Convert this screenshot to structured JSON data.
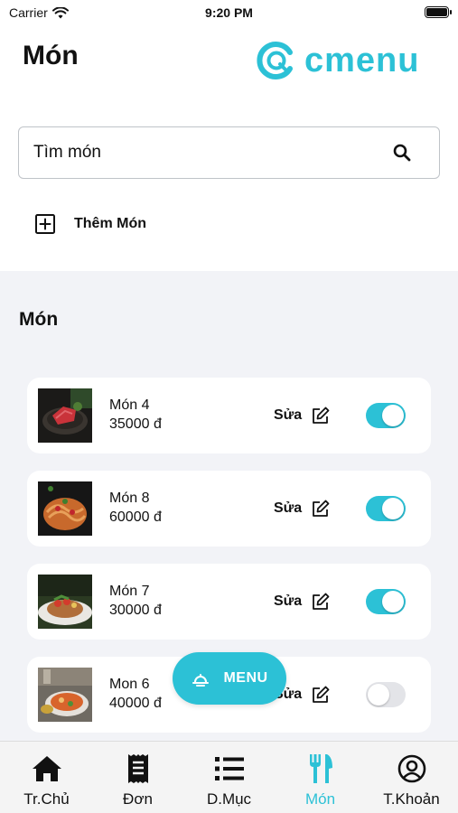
{
  "status_bar": {
    "carrier": "Carrier",
    "time": "9:20 PM"
  },
  "header": {
    "title": "Món",
    "logo_text": "cmenu"
  },
  "search": {
    "value": "Tìm món"
  },
  "add_dish": {
    "label": "Thêm Món"
  },
  "section": {
    "title": "Món"
  },
  "dishes": [
    {
      "name": "Món 4",
      "price": "35000 đ",
      "edit_label": "Sửa",
      "enabled": true
    },
    {
      "name": "Món 8",
      "price": "60000 đ",
      "edit_label": "Sửa",
      "enabled": true
    },
    {
      "name": "Món 7",
      "price": "30000 đ",
      "edit_label": "Sửa",
      "enabled": true
    },
    {
      "name": "Mon 6",
      "price": "40000 đ",
      "edit_label": "Sửa",
      "enabled": false
    }
  ],
  "fab": {
    "label": "MENU"
  },
  "tabs": [
    {
      "label": "Tr.Chủ",
      "icon": "home-icon",
      "active": false
    },
    {
      "label": "Đơn",
      "icon": "receipt-icon",
      "active": false
    },
    {
      "label": "D.Mục",
      "icon": "list-icon",
      "active": false
    },
    {
      "label": "Món",
      "icon": "utensils-icon",
      "active": true
    },
    {
      "label": "T.Khoản",
      "icon": "account-icon",
      "active": false
    }
  ],
  "colors": {
    "accent": "#2cc1d6",
    "section_bg": "#f2f3f7",
    "toggle_off": "#e3e4e8"
  }
}
